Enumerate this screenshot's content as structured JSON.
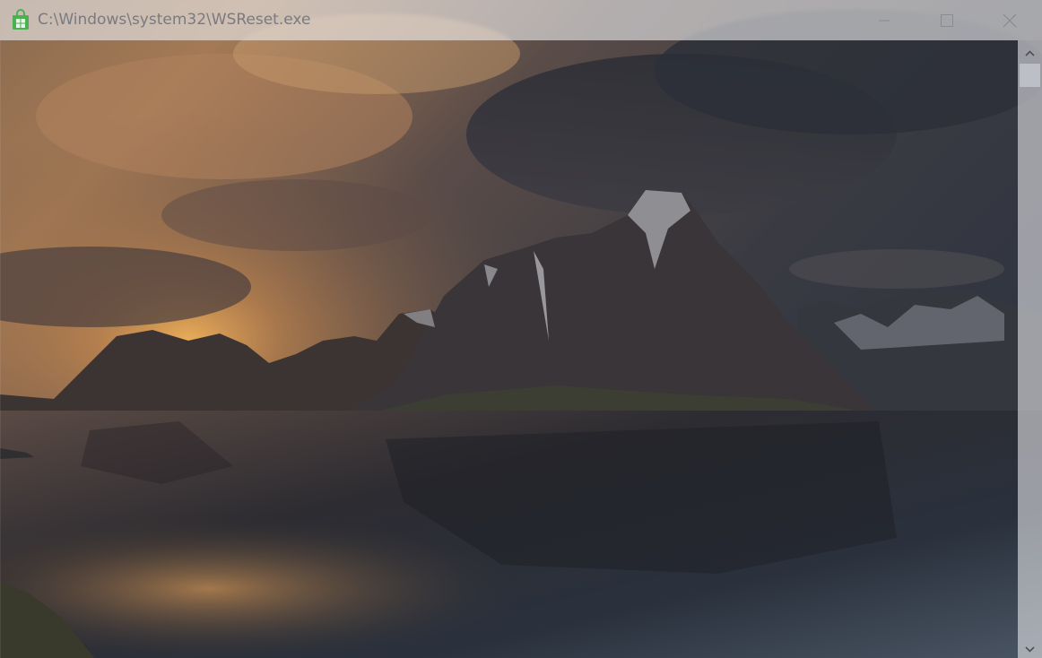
{
  "window": {
    "title": "C:\\Windows\\system32\\WSReset.exe",
    "icon": "store-bag-icon",
    "accent_color": "#4caf50"
  },
  "caption_buttons": {
    "minimize": "minimize-icon",
    "maximize": "maximize-icon",
    "close": "close-icon"
  },
  "scrollbar": {
    "up": "chevron-up-icon",
    "down": "chevron-down-icon"
  }
}
